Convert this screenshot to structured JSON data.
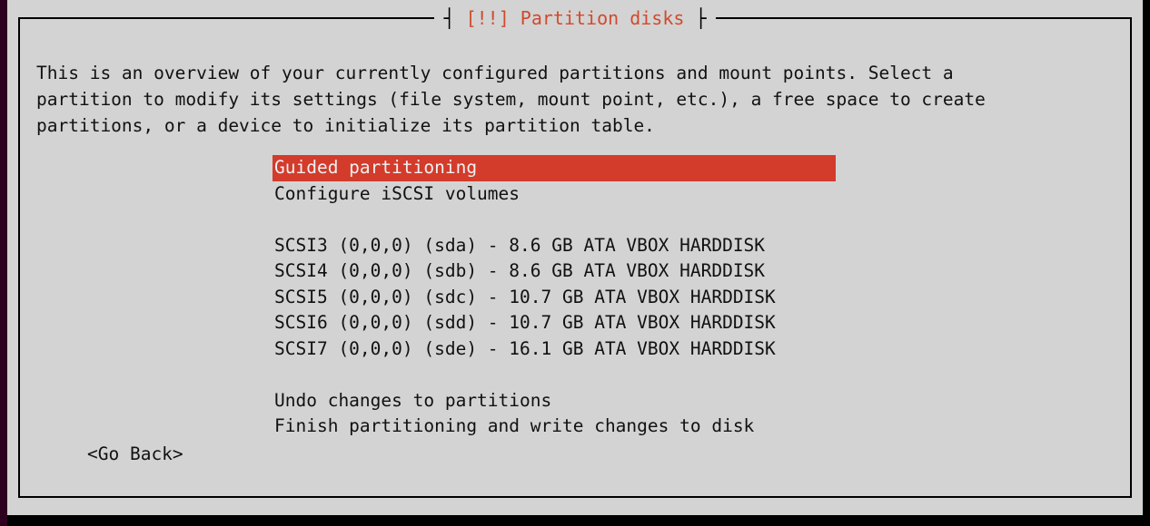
{
  "dialog": {
    "title": "[!!] Partition disks",
    "description_lines": [
      "This is an overview of your currently configured partitions and mount points. Select a",
      "partition to modify its settings (file system, mount point, etc.), a free space to create",
      "partitions, or a device to initialize its partition table."
    ]
  },
  "menu": {
    "guided": "Guided partitioning",
    "iscsi": "Configure iSCSI volumes",
    "disks": [
      "SCSI3 (0,0,0) (sda) - 8.6 GB ATA VBOX HARDDISK",
      "SCSI4 (0,0,0) (sdb) - 8.6 GB ATA VBOX HARDDISK",
      "SCSI5 (0,0,0) (sdc) - 10.7 GB ATA VBOX HARDDISK",
      "SCSI6 (0,0,0) (sdd) - 10.7 GB ATA VBOX HARDDISK",
      "SCSI7 (0,0,0) (sde) - 16.1 GB ATA VBOX HARDDISK"
    ],
    "undo": "Undo changes to partitions",
    "finish": "Finish partitioning and write changes to disk"
  },
  "buttons": {
    "go_back": "<Go Back>"
  },
  "colors": {
    "background": "#d3d3d3",
    "selection": "#d33b2b",
    "title_text": "#d04a2e",
    "border": "#2c001e"
  }
}
